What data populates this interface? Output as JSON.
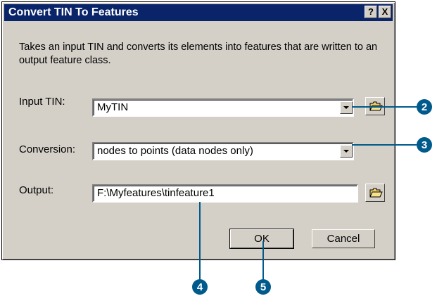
{
  "dialog": {
    "title": "Convert TIN To Features",
    "help_label": "?",
    "close_label": "X",
    "description": "Takes an input TIN and converts its elements into features that are written to an output feature class."
  },
  "fields": {
    "input_tin": {
      "label": "Input TIN:",
      "value": "MyTIN"
    },
    "conversion": {
      "label": "Conversion:",
      "value": "nodes to points (data nodes only)"
    },
    "output": {
      "label": "Output:",
      "value": "F:\\Myfeatures\\tinfeature1"
    }
  },
  "buttons": {
    "ok": "OK",
    "cancel": "Cancel"
  },
  "callouts": [
    "2",
    "3",
    "4",
    "5"
  ],
  "colors": {
    "titlebar": "#0a246a",
    "face": "#d4d0c8",
    "callout": "#005a8c"
  }
}
